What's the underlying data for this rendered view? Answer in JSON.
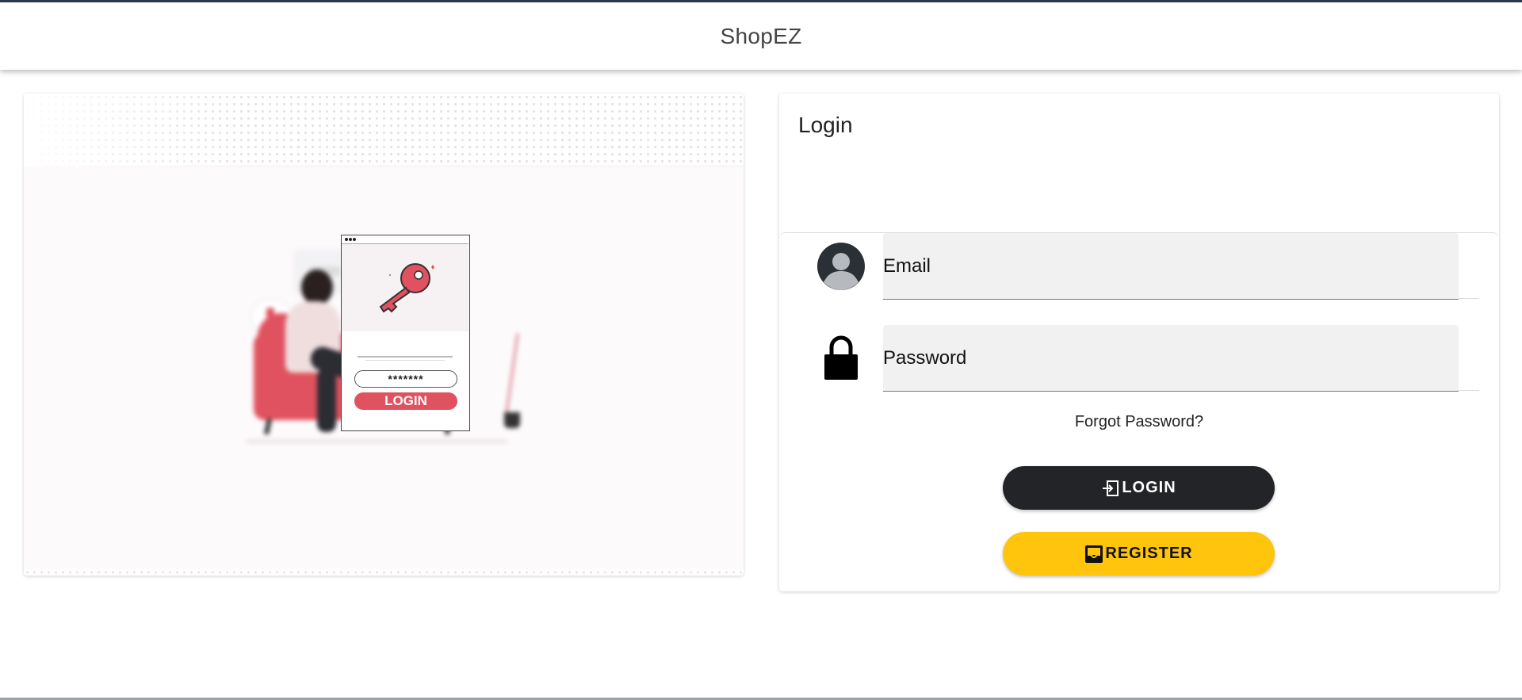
{
  "app": {
    "title": "ShopEZ"
  },
  "illustration": {
    "phone_password": "*******",
    "phone_button": "LOGIN",
    "key_icon": "key-icon"
  },
  "login": {
    "title": "Login",
    "email": {
      "placeholder": "Email",
      "value": "",
      "icon": "account-circle-icon"
    },
    "password": {
      "placeholder": "Password",
      "value": "",
      "icon": "lock-icon"
    },
    "forgot_password": "Forgot Password?",
    "login_button": {
      "label": "LOGIN",
      "icon": "login-icon",
      "color": "#232427"
    },
    "register_button": {
      "label": "REGISTER",
      "icon": "inbox-icon",
      "color": "#ffc40c"
    }
  }
}
